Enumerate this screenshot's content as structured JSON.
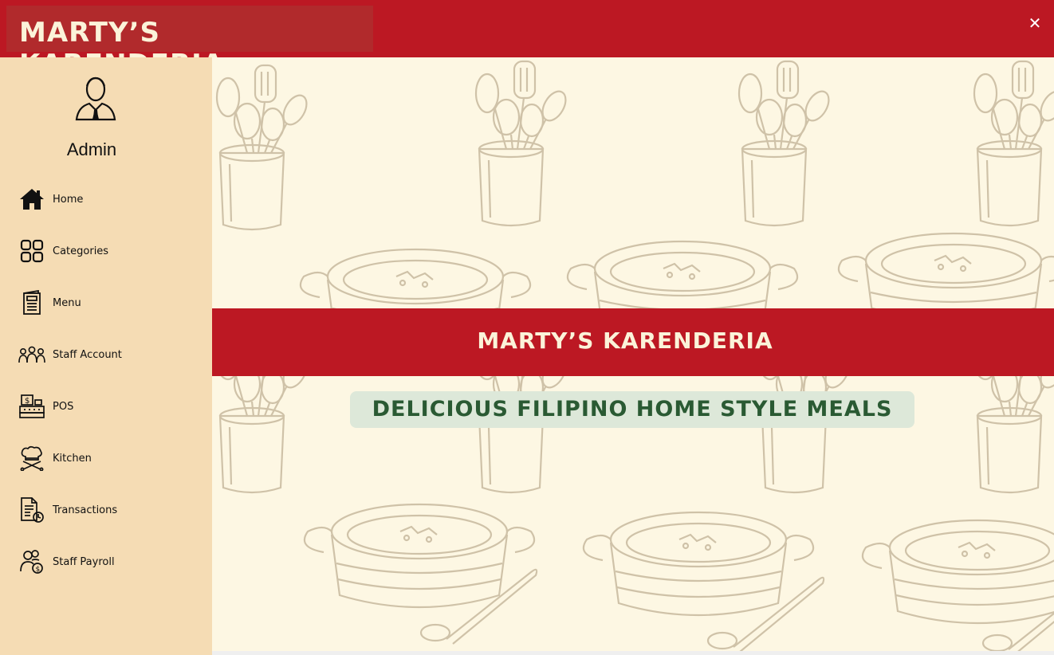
{
  "app": {
    "title": "MARTY’S KARENDERIA",
    "close_label": "✕"
  },
  "sidebar": {
    "user_role": "Admin",
    "user_icon": "admin-user-icon",
    "items": [
      {
        "label": "Home",
        "icon": "home-icon"
      },
      {
        "label": "Categories",
        "icon": "categories-grid-icon"
      },
      {
        "label": "Menu",
        "icon": "menu-card-icon"
      },
      {
        "label": "Staff Account",
        "icon": "staff-group-icon"
      },
      {
        "label": "POS",
        "icon": "pos-register-icon"
      },
      {
        "label": "Kitchen",
        "icon": "chef-kitchen-icon"
      },
      {
        "label": "Transactions",
        "icon": "transactions-document-icon"
      },
      {
        "label": "Staff Payroll",
        "icon": "payroll-icon"
      }
    ]
  },
  "main": {
    "banner_title": "MARTY’S KARENDERIA",
    "tagline": "DELICIOUS FILIPINO HOME STYLE MEALS"
  },
  "colors": {
    "brand_red": "#bc1823",
    "sidebar_bg": "#f5dcb4",
    "content_bg": "#fdf7e3",
    "tagline_green": "#2a5a33",
    "tagline_bg": "#dde8d9"
  }
}
